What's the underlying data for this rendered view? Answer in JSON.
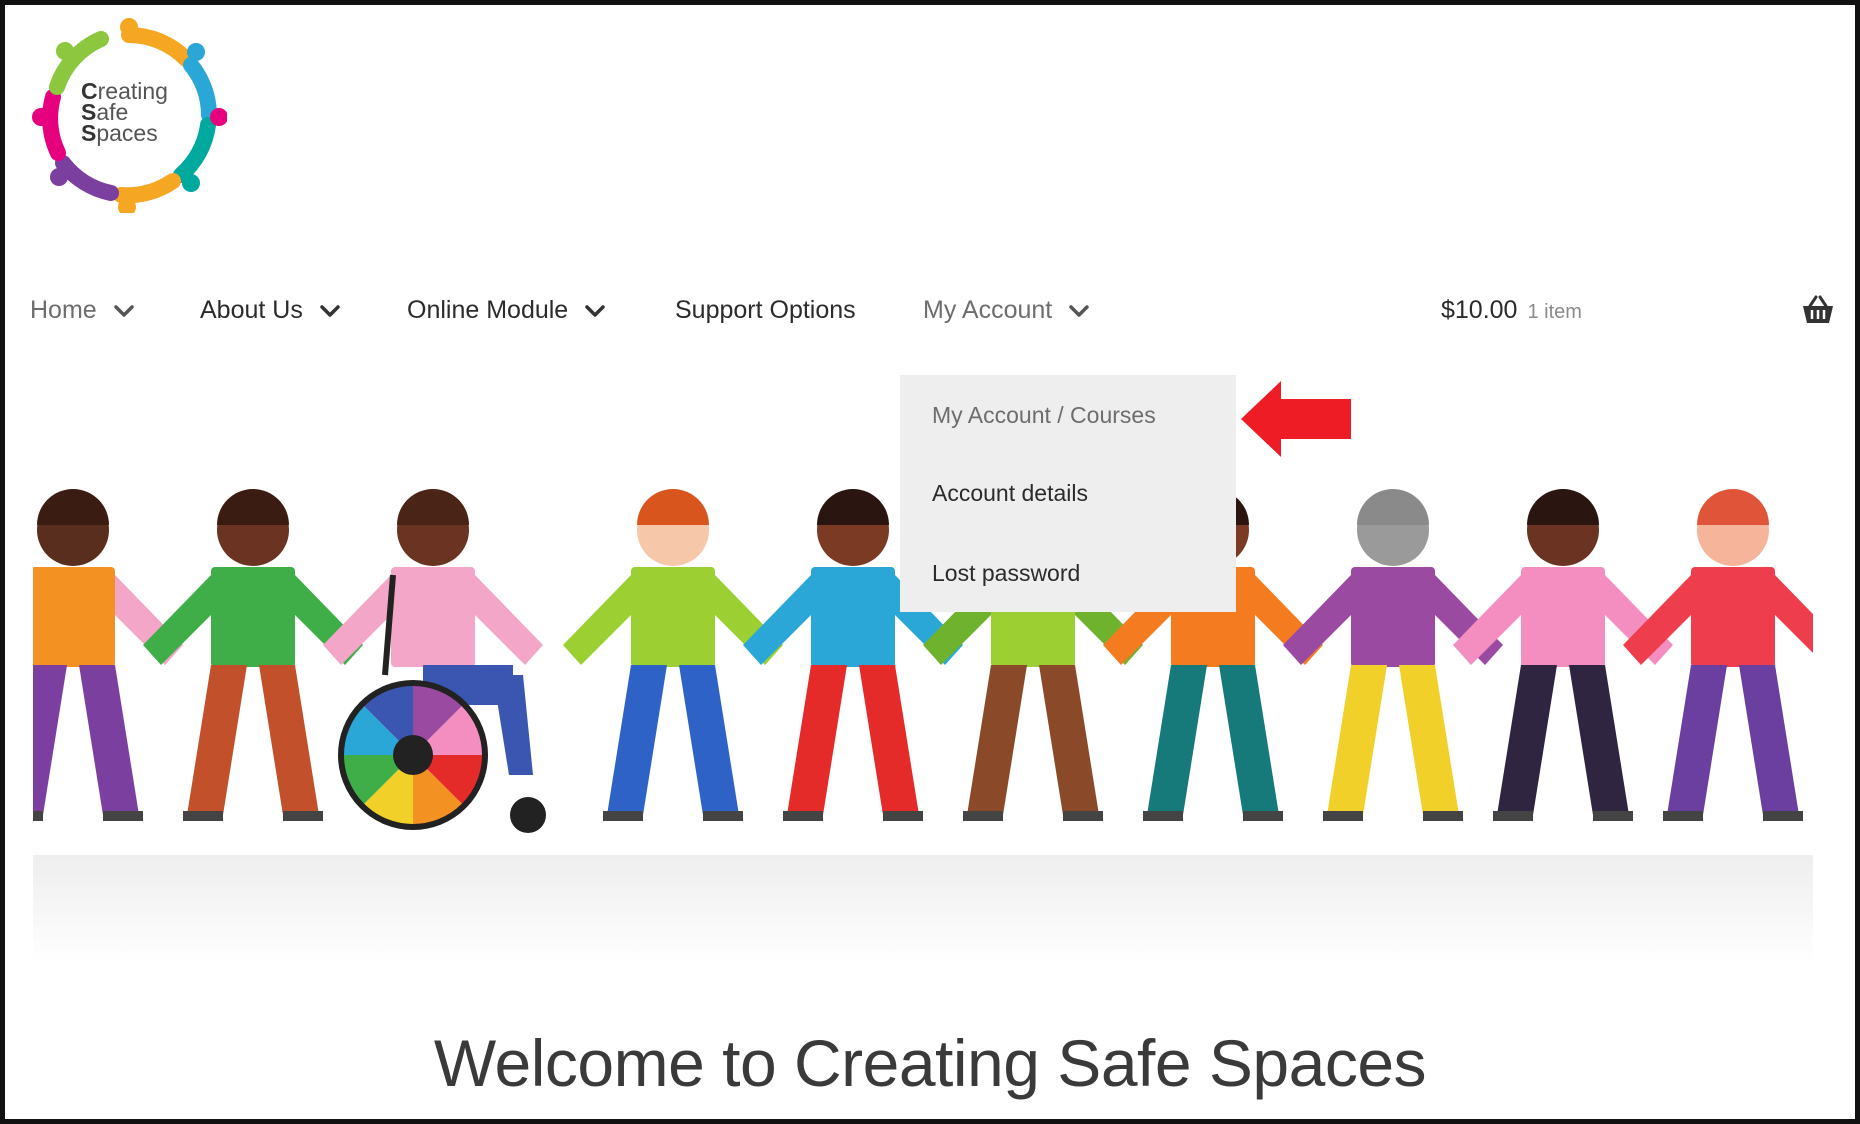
{
  "logo": {
    "lines": [
      {
        "first": "C",
        "rest": "reating"
      },
      {
        "first": "S",
        "rest": "afe"
      },
      {
        "first": "S",
        "rest": "paces"
      }
    ],
    "colors": [
      "#f5a623",
      "#2aa7d6",
      "#e6007e",
      "#7b3fa0",
      "#8dc63f",
      "#00a99d"
    ]
  },
  "nav": {
    "items": [
      {
        "label": "Home",
        "has_dropdown": true
      },
      {
        "label": "About Us",
        "has_dropdown": true
      },
      {
        "label": "Online Module",
        "has_dropdown": true
      },
      {
        "label": "Support Options",
        "has_dropdown": false
      },
      {
        "label": "My Account",
        "has_dropdown": true
      }
    ],
    "cart_total": "$10.00",
    "cart_count": "1 item",
    "cart_icon": "basket-icon"
  },
  "dropdown": {
    "items": [
      {
        "label": "My Account / Courses"
      },
      {
        "label": "Account details"
      },
      {
        "label": "Lost password"
      }
    ]
  },
  "annotation": {
    "arrow_color": "#ee1c25"
  },
  "page": {
    "title": "Welcome to Creating Safe Spaces"
  }
}
